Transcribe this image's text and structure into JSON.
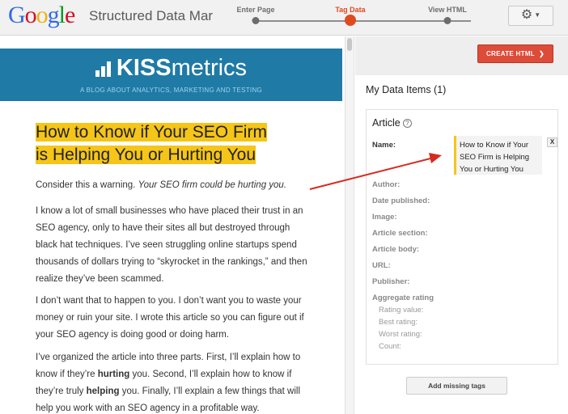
{
  "header": {
    "logo_letters": [
      {
        "char": "G",
        "color": "#3369e8"
      },
      {
        "char": "o",
        "color": "#d50f25"
      },
      {
        "char": "o",
        "color": "#eeb211"
      },
      {
        "char": "g",
        "color": "#3369e8"
      },
      {
        "char": "l",
        "color": "#009925"
      },
      {
        "char": "e",
        "color": "#d50f25"
      }
    ],
    "app_title": "Structured Data Mar",
    "steps": [
      {
        "label": "Enter Page",
        "active": false
      },
      {
        "label": "Tag Data",
        "active": true
      },
      {
        "label": "View HTML",
        "active": false
      }
    ],
    "gear_icon": "gear-icon"
  },
  "article": {
    "site_name_bold": "KISS",
    "site_name_rest": "metrics",
    "tagline": "A BLOG ABOUT ANALYTICS, MARKETING AND TESTING",
    "title_line1": "How to Know if Your SEO Firm",
    "title_line2": "is Helping You or Hurting You",
    "p1_a": "Consider this a warning. ",
    "p1_b": "Your SEO firm could be hurting you.",
    "p2": "I know a lot of small businesses who have placed their trust in an SEO agency, only to have their sites all but destroyed through black hat techniques. I’ve seen struggling online startups spend thousands of dollars trying to “skyrocket in the rankings,” and then realize they’ve been scammed.",
    "p3": "I don’t want that to happen to you. I don’t want you to waste your money or ruin your site. I wrote this article so you can figure out if your SEO agency is doing good or doing harm.",
    "p4_a": "I’ve organized the article into three parts. First, I’ll explain how to know if they’re ",
    "p4_b": "hurting",
    "p4_c": " you. Second, I’ll explain how to know if they’re truly ",
    "p4_d": "helping",
    "p4_e": " you. Finally, I’ll explain a few things that will help you work with an SEO agency in a profitable way."
  },
  "panel": {
    "create_button": "CREATE HTML",
    "create_chevron": "❯",
    "items_heading": "My Data Items (1)",
    "card_title": "Article",
    "help_icon": "?",
    "fields": [
      "Name:",
      "Author:",
      "Date published:",
      "Image:",
      "Article section:",
      "Article body:",
      "URL:",
      "Publisher:",
      "Aggregate rating"
    ],
    "rating_subfields": [
      "Rating value:",
      "Best rating:",
      "Worst rating:",
      "Count:"
    ],
    "name_value": "How to Know if Your SEO Firm is Helping You or Hurting You",
    "remove_label": "X",
    "add_missing": "Add missing tags"
  },
  "colors": {
    "accent": "#e04a1f",
    "highlight": "#f5c518",
    "banner": "#1f7aa6",
    "arrow": "#d62b20"
  }
}
